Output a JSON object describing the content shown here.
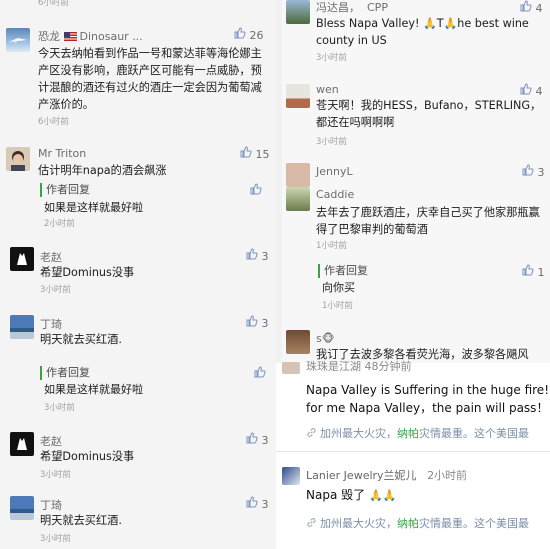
{
  "left": {
    "top_partial": {
      "text": "6小时前"
    },
    "comments": [
      {
        "user": "恐龙",
        "suffix": "Dinosaur ...",
        "likes": "26",
        "text": "今天去纳帕看到作品一号和蒙达菲等海伦娜主产区没有影响，鹿跃产区可能有一点威胁，预计混酿的酒还有过火的酒庄一定会因为葡萄减产涨价的。",
        "time": "6小时前"
      },
      {
        "user": "Mr Triton",
        "likes": "15",
        "text": "估计明年napa的酒会飙涨",
        "reply_label": "作者回复",
        "reply_text": "如果是这样就最好啦",
        "reply_time": "2小时前"
      },
      {
        "user": "老赵",
        "likes": "3",
        "text": "希望Dominus没事",
        "time": "3小时前"
      },
      {
        "user": "丁琦",
        "likes": "3",
        "text": "明天就去买红酒.",
        "reply_label": "作者回复",
        "reply_text": "如果是这样就最好啦",
        "reply_time": "3小时前"
      },
      {
        "user": "老赵",
        "likes": "3",
        "text": "希望Dominus没事",
        "time": "3小时前"
      },
      {
        "user": "丁琦",
        "likes": "3",
        "text": "明天就去买红酒.",
        "time": "3小时前"
      }
    ]
  },
  "right": {
    "comments": [
      {
        "user": "冯达昌，",
        "suffix": "CPP",
        "likes": "4",
        "text_a": "Bless Napa Valley! ",
        "text_b": "T",
        "text_c": "he best wine county in US",
        "time": "3小时前"
      },
      {
        "user": "wen",
        "likes": "4",
        "text": "苍天啊！我的HESS，Bufano，STERLING，都还在吗啊啊啊",
        "time": "3小时前"
      },
      {
        "user": "JennyL",
        "likes": "3"
      },
      {
        "user": "Caddie",
        "text": "去年去了鹿跃酒庄，庆幸自己买了他家那瓶赢得了巴黎审判的葡萄酒",
        "time": "1小时前",
        "reply_label": "作者回复",
        "reply_text": "向你买",
        "reply_time": "1小时前",
        "reply_likes": "1"
      },
      {
        "user": "s🐵",
        "text": "我订了去波多黎各看荧光海，波多黎各飓风"
      }
    ]
  },
  "overlay": {
    "header_partial": "珠珠是江湖   48分钟前",
    "comment1_text_line1": "Napa Valley is Suffering in the huge fire!  d",
    "comment1_text_line2": "for me Napa Valley，the pain will pass！",
    "link1": {
      "pre": "加州最大火灾，",
      "hl": "纳帕",
      "post": "灾情最重。这个美国最"
    },
    "comment2_user": "Lanier Jewelry兰妮儿",
    "comment2_time": "2小时前",
    "comment2_text": "Napa 毁了",
    "link2": {
      "pre": "加州最大火灾，",
      "hl": "纳帕",
      "post": "灾情最重。这个美国最"
    }
  },
  "colors": {
    "green": "#3aa347",
    "link": "#7a8fa8",
    "like": "#7a93c0"
  }
}
